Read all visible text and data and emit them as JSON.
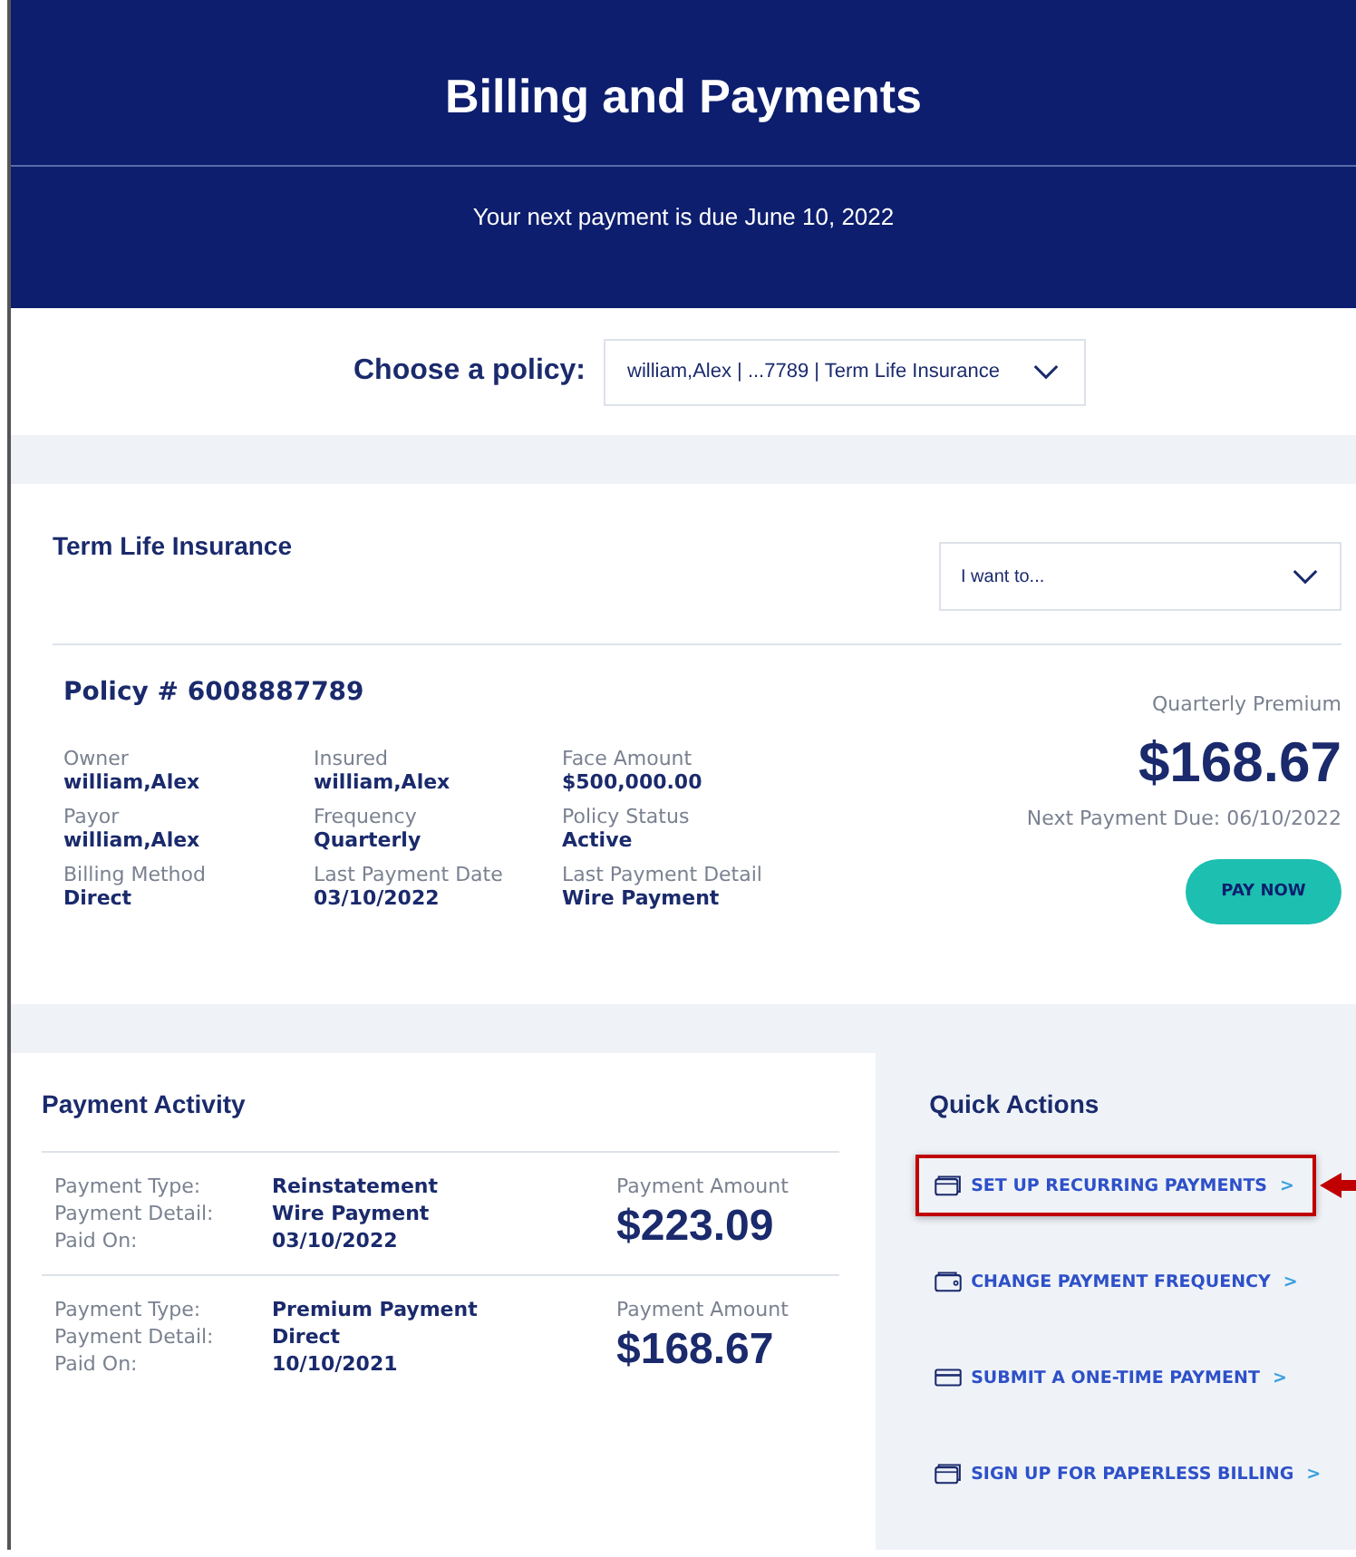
{
  "header": {
    "title": "Billing and Payments",
    "subtitle": "Your next payment is due June 10, 2022"
  },
  "policy_chooser": {
    "label": "Choose a policy:",
    "value": "william,Alex | ...7789 | Term Life Insurance"
  },
  "policy_card": {
    "title": "Term Life Insurance",
    "action_select": {
      "placeholder": "I want to..."
    },
    "policy_number": "Policy # 6008887789",
    "fields": [
      {
        "label": "Owner",
        "value": "william,Alex"
      },
      {
        "label": "Insured",
        "value": "william,Alex"
      },
      {
        "label": "Face Amount",
        "value": "$500,000.00"
      },
      {
        "label": "Payor",
        "value": "william,Alex"
      },
      {
        "label": "Frequency",
        "value": "Quarterly"
      },
      {
        "label": "Policy Status",
        "value": "Active"
      },
      {
        "label": "Billing Method",
        "value": "Direct"
      },
      {
        "label": "Last Payment Date",
        "value": "03/10/2022"
      },
      {
        "label": "Last Payment Detail",
        "value": "Wire Payment"
      }
    ],
    "premium_label": "Quarterly Premium",
    "premium_amount": "$168.67",
    "next_due": "Next Payment Due: 06/10/2022",
    "pay_button": "PAY NOW"
  },
  "payment_activity": {
    "title": "Payment Activity",
    "payments": [
      {
        "type_label": "Payment Type:",
        "type": "Reinstatement",
        "detail_label": "Payment Detail:",
        "detail": "Wire Payment",
        "paid_label": "Paid On:",
        "paid": "03/10/2022",
        "amount_label": "Payment Amount",
        "amount": "$223.09"
      },
      {
        "type_label": "Payment Type:",
        "type": "Premium Payment",
        "detail_label": "Payment Detail:",
        "detail": "Direct",
        "paid_label": "Paid On:",
        "paid": "10/10/2021",
        "amount_label": "Payment Amount",
        "amount": "$168.67"
      }
    ]
  },
  "quick_actions": {
    "title": "Quick Actions",
    "items": [
      {
        "label": "SET UP RECURRING PAYMENTS",
        "chevron": ">",
        "highlighted": true
      },
      {
        "label": "CHANGE PAYMENT FREQUENCY",
        "chevron": ">",
        "highlighted": false
      },
      {
        "label": "SUBMIT A ONE-TIME PAYMENT",
        "chevron": ">",
        "highlighted": false
      },
      {
        "label": "SIGN UP FOR PAPERLESS BILLING",
        "chevron": ">",
        "highlighted": false
      }
    ]
  }
}
